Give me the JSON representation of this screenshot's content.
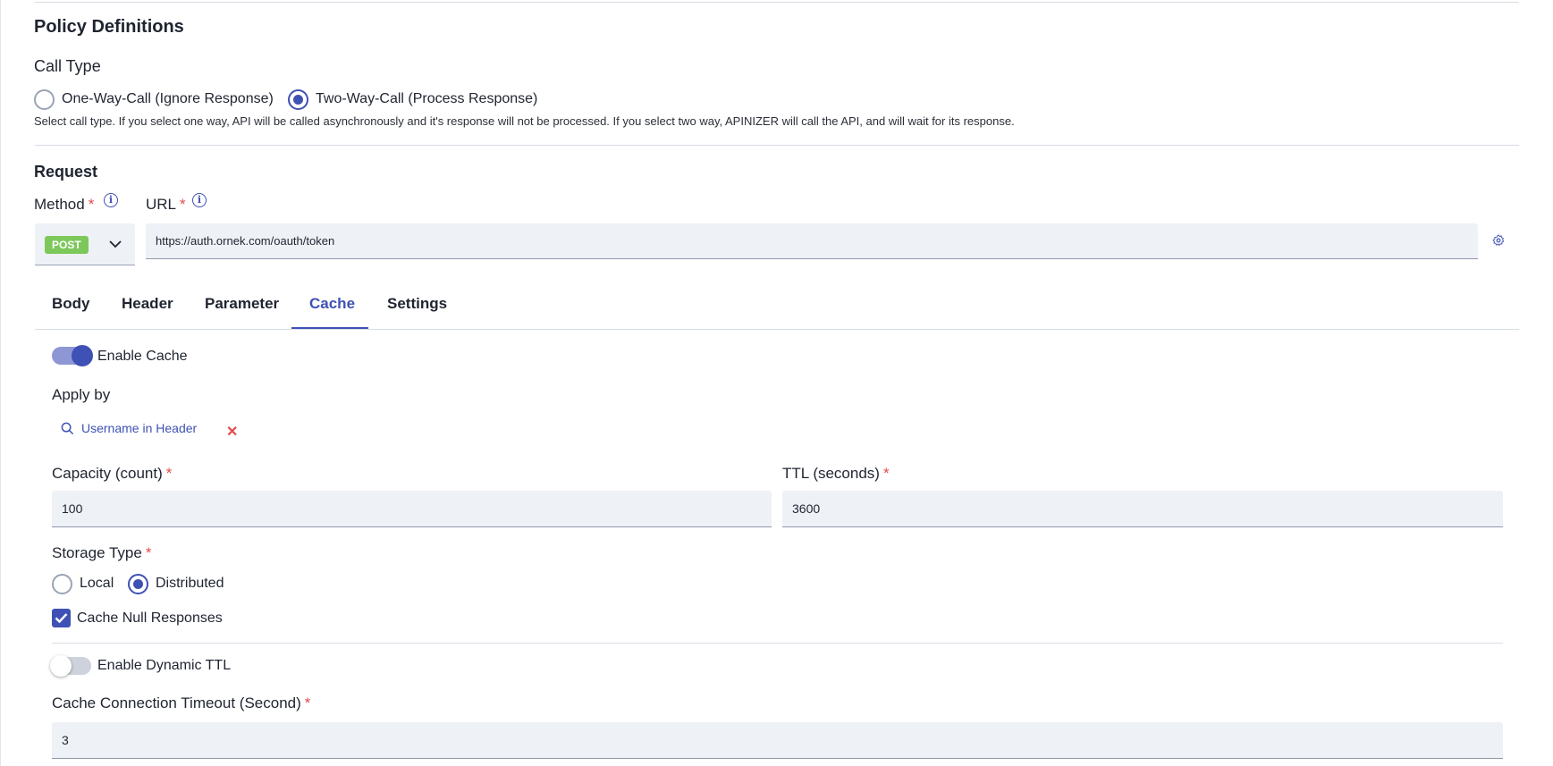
{
  "policy": {
    "title": "Policy Definitions"
  },
  "call_type": {
    "label": "Call Type",
    "options": [
      "One-Way-Call (Ignore Response)",
      "Two-Way-Call (Process Response)"
    ],
    "selected": "Two-Way-Call (Process Response)",
    "hint": "Select call type. If you select one way, API will be called asynchronously and it's response will not be processed. If you select two way, APINIZER will call the API, and will wait for its response."
  },
  "request": {
    "title": "Request",
    "method_label": "Method",
    "url_label": "URL",
    "required_mark": "*",
    "method_value": "POST",
    "url_value": "https://auth.ornek.com/oauth/token"
  },
  "tabs": [
    "Body",
    "Header",
    "Parameter",
    "Cache",
    "Settings"
  ],
  "active_tab": "Cache",
  "cache": {
    "enable_cache_label": "Enable Cache",
    "enable_cache": true,
    "apply_by_label": "Apply by",
    "apply_by_value": "Username in Header",
    "capacity_label": "Capacity (count)",
    "capacity_value": "100",
    "ttl_label": "TTL (seconds)",
    "ttl_value": "3600",
    "storage_type_label": "Storage Type",
    "storage_options": [
      "Local",
      "Distributed"
    ],
    "storage_selected": "Distributed",
    "cache_null_label": "Cache Null Responses",
    "cache_null": true,
    "dynamic_ttl_label": "Enable Dynamic TTL",
    "dynamic_ttl": false,
    "timeout_label": "Cache Connection Timeout (Second)",
    "timeout_value": "3"
  },
  "colors": {
    "accent": "#3f51b5",
    "required": "#e24b4b",
    "method_badge": "#7dc85a",
    "input_bg": "#eef1f6"
  }
}
